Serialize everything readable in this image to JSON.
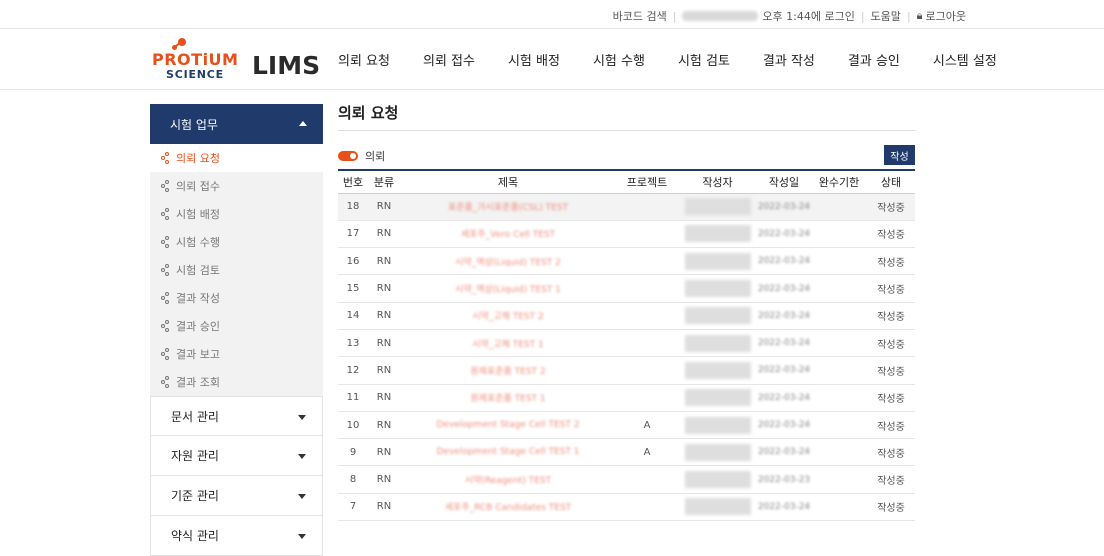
{
  "topbar": {
    "barcode_search": "바코드 검색",
    "login_info": "오후 1:44에 로그인",
    "help": "도움말",
    "logout": "로그아웃"
  },
  "logo": {
    "brand_top": "PROTiUM",
    "brand_bottom": "SCIENCE",
    "product": "LIMS"
  },
  "nav": [
    "의뢰 요청",
    "의뢰 접수",
    "시험 배정",
    "시험 수행",
    "시험 검토",
    "결과 작성",
    "결과 승인",
    "시스템 설정"
  ],
  "sidebar": {
    "group_title": "시험 업무",
    "items": [
      {
        "label": "의뢰 요청"
      },
      {
        "label": "의뢰 접수"
      },
      {
        "label": "시험 배정"
      },
      {
        "label": "시험 수행"
      },
      {
        "label": "시험 검토"
      },
      {
        "label": "결과 작성"
      },
      {
        "label": "결과 승인"
      },
      {
        "label": "결과 보고"
      },
      {
        "label": "결과 조회"
      }
    ],
    "sections": [
      "문서 관리",
      "자원 관리",
      "기준 관리",
      "약식 관리"
    ]
  },
  "main": {
    "title": "의뢰 요청",
    "toggle_label": "의뢰",
    "write_button": "작성",
    "columns": [
      "번호",
      "분류",
      "제목",
      "프로젝트",
      "작성자",
      "작성일",
      "완수기한",
      "상태"
    ],
    "rows": [
      {
        "no": "18",
        "type": "RN",
        "title": "표준품_가시표준품(CSL) TEST",
        "project": "",
        "date": "2022-03-24",
        "status": "작성중"
      },
      {
        "no": "17",
        "type": "RN",
        "title": "세포주_Vero Cell TEST",
        "project": "",
        "date": "2022-03-24",
        "status": "작성중"
      },
      {
        "no": "16",
        "type": "RN",
        "title": "시약_액상(Liquid) TEST 2",
        "project": "",
        "date": "2022-03-24",
        "status": "작성중"
      },
      {
        "no": "15",
        "type": "RN",
        "title": "시약_액상(Liquid) TEST 1",
        "project": "",
        "date": "2022-03-24",
        "status": "작성중"
      },
      {
        "no": "14",
        "type": "RN",
        "title": "시약_고체 TEST 2",
        "project": "",
        "date": "2022-03-24",
        "status": "작성중"
      },
      {
        "no": "13",
        "type": "RN",
        "title": "시약_고체 TEST 1",
        "project": "",
        "date": "2022-03-24",
        "status": "작성중"
      },
      {
        "no": "12",
        "type": "RN",
        "title": "원제표준품 TEST 2",
        "project": "",
        "date": "2022-03-24",
        "status": "작성중"
      },
      {
        "no": "11",
        "type": "RN",
        "title": "원제표준품 TEST 1",
        "project": "",
        "date": "2022-03-24",
        "status": "작성중"
      },
      {
        "no": "10",
        "type": "RN",
        "title": "Development Stage Cell TEST 2",
        "project": "A",
        "date": "2022-03-24",
        "status": "작성중"
      },
      {
        "no": "9",
        "type": "RN",
        "title": "Development Stage Cell TEST 1",
        "project": "A",
        "date": "2022-03-24",
        "status": "작성중"
      },
      {
        "no": "8",
        "type": "RN",
        "title": "시약(Reagent) TEST",
        "project": "",
        "date": "2022-03-23",
        "status": "작성중"
      },
      {
        "no": "7",
        "type": "RN",
        "title": "세포주_RCB Candidates TEST",
        "project": "",
        "date": "2022-03-24",
        "status": "작성중"
      }
    ]
  },
  "colors": {
    "accent": "#e8501b",
    "navy": "#203a6b"
  }
}
